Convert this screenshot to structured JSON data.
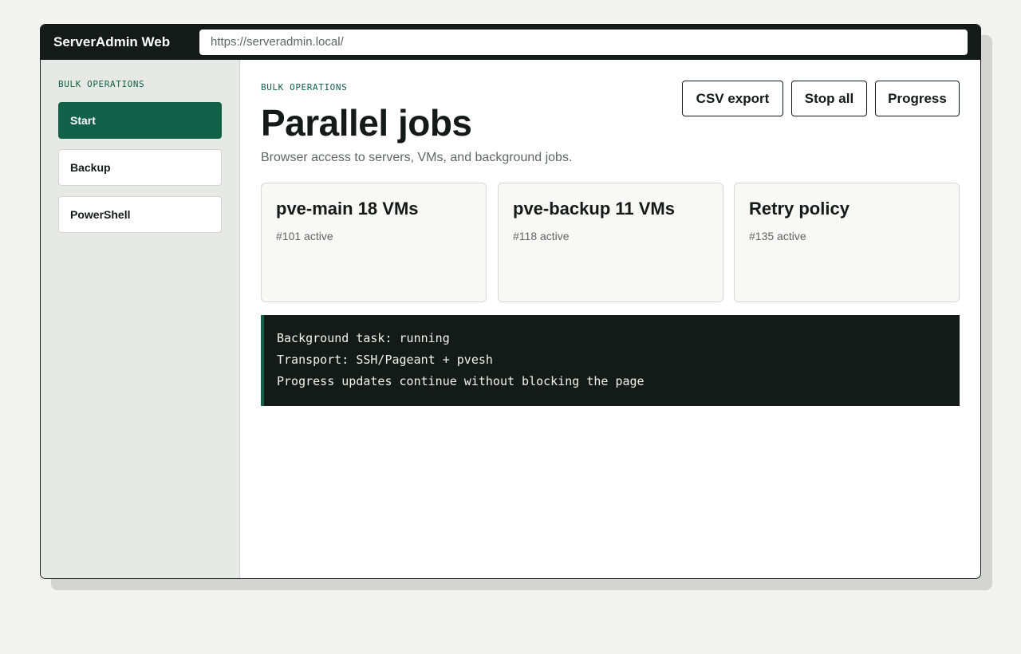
{
  "window": {
    "app_title": "ServerAdmin Web",
    "url": "https://serveradmin.local/"
  },
  "sidebar": {
    "section_label": "BULK OPERATIONS",
    "items": [
      {
        "label": "Start",
        "active": true
      },
      {
        "label": "Backup",
        "active": false
      },
      {
        "label": "PowerShell",
        "active": false
      }
    ]
  },
  "main": {
    "eyebrow": "BULK OPERATIONS",
    "title": "Parallel jobs",
    "subtitle": "Browser access to servers, VMs, and background jobs.",
    "actions": {
      "csv_export": "CSV export",
      "stop_all": "Stop all",
      "progress": "Progress"
    },
    "cards": [
      {
        "title": "pve-main 18 VMs",
        "meta": "#101 active"
      },
      {
        "title": "pve-backup 11 VMs",
        "meta": "#118 active"
      },
      {
        "title": "Retry policy",
        "meta": "#135 active"
      }
    ],
    "terminal_lines": [
      "Background task: running",
      "Transport: SSH/Pageant + pvesh",
      "Progress updates continue without blocking the page"
    ]
  },
  "colors": {
    "accent": "#116149",
    "dark": "#131a18",
    "page_background": "#f3f3ef",
    "sidebar_background": "#e6e9e6"
  }
}
